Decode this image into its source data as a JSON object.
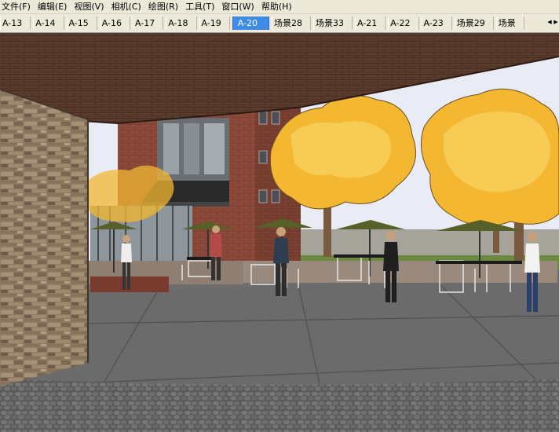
{
  "menu": [
    {
      "label": "文件(F)"
    },
    {
      "label": "编辑(E)"
    },
    {
      "label": "视图(V)"
    },
    {
      "label": "相机(C)"
    },
    {
      "label": "绘图(R)"
    },
    {
      "label": "工具(T)"
    },
    {
      "label": "窗口(W)"
    },
    {
      "label": "帮助(H)"
    }
  ],
  "scene_tabs": [
    {
      "label": "A-13"
    },
    {
      "label": "A-14"
    },
    {
      "label": "A-15"
    },
    {
      "label": "A-16"
    },
    {
      "label": "A-17"
    },
    {
      "label": "A-18"
    },
    {
      "label": "A-19"
    },
    {
      "label": "A-20",
      "active": true
    },
    {
      "label": "场景28"
    },
    {
      "label": "场景33"
    },
    {
      "label": "A-21"
    },
    {
      "label": "A-22"
    },
    {
      "label": "A-23"
    },
    {
      "label": "场景29"
    },
    {
      "label": "场景"
    }
  ],
  "tab_scroll": {
    "left_icon": "arrow-left-icon",
    "right_icon": "arrow-right-icon"
  },
  "viewport": {
    "description_icon": "sketchup-3d-scene",
    "colors": {
      "sky": "#e9ecf5",
      "ceiling": "#5a3b2c",
      "brick": "#8b4a3a",
      "stone": "#8d7a63",
      "tree_foliage": "#f3b731",
      "tree_foliage_light": "#f7cc55",
      "pavement": "#6b6b6b",
      "cobble": "#6d6d6d",
      "grass": "#6c8a3f",
      "umbrella": "#58602a"
    }
  }
}
